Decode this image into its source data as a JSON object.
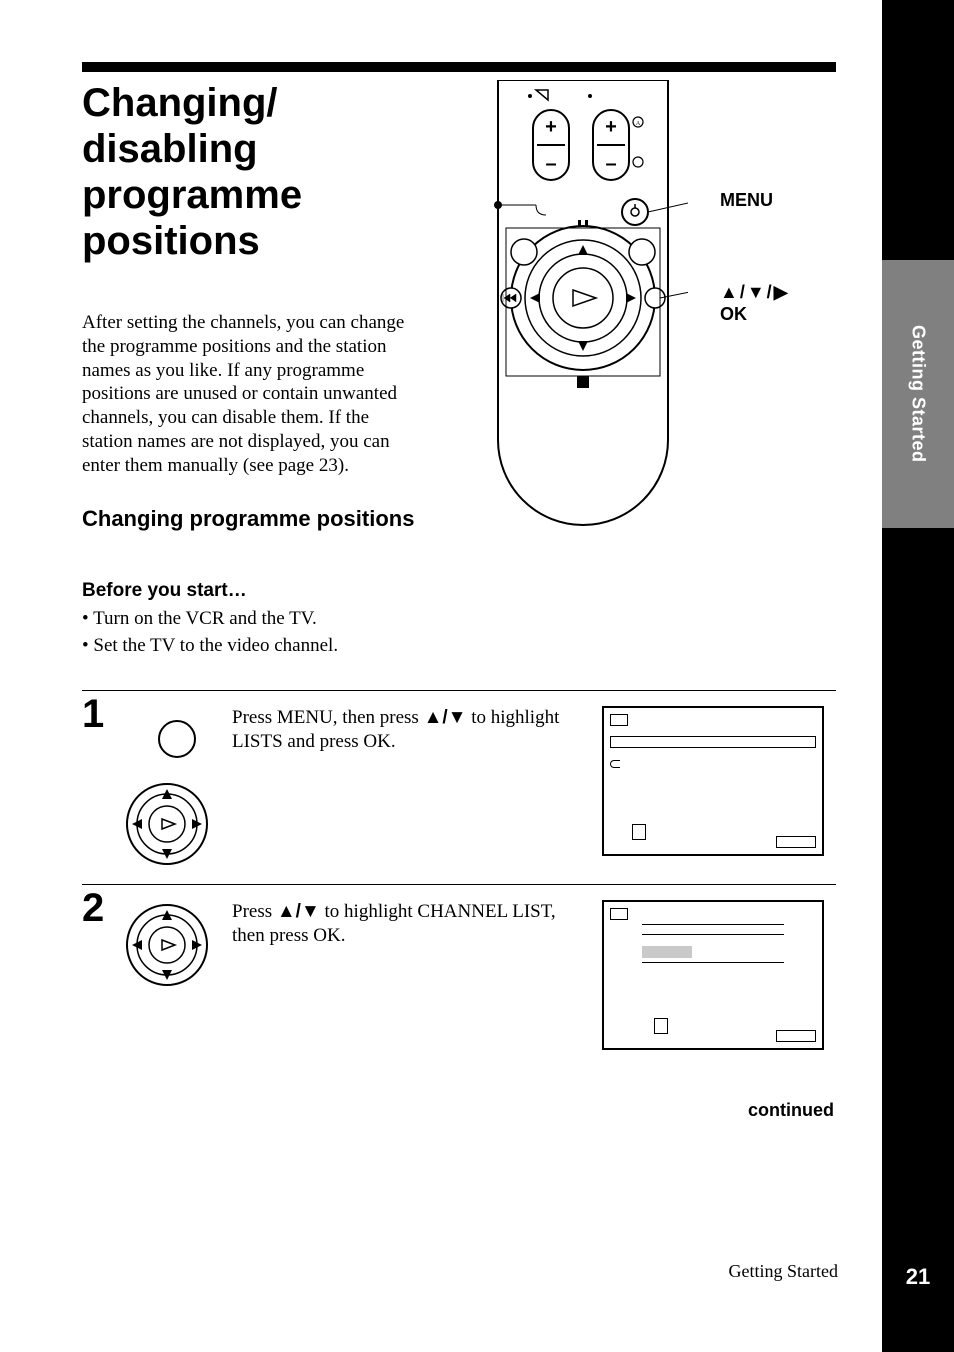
{
  "title": "Changing/ disabling programme positions",
  "intro": "After setting the channels, you can change the programme positions and the station names as you like. If any programme positions are unused or contain unwanted channels, you can disable them. If the station names are not displayed, you can enter them manually (see page 23).",
  "remote_labels": {
    "menu": "MENU",
    "arrows": "↑/↓/→",
    "ok": "OK"
  },
  "subsection": "Changing programme positions",
  "before_heading": "Before you start…",
  "before_items": [
    "Turn on the VCR and the TV.",
    "Set the TV to the video channel."
  ],
  "steps": [
    {
      "num": "1",
      "text_pre": "Press MENU, then press ",
      "text_mid": " to highlight LISTS and press OK."
    },
    {
      "num": "2",
      "text_pre": "Press ",
      "text_mid": " to highlight CHANNEL LIST, then press OK."
    }
  ],
  "arrow_pair": "↑/↓",
  "continued": "continued",
  "footer_section": "Getting Started",
  "side_tab": "Getting Started",
  "page_number": "21"
}
